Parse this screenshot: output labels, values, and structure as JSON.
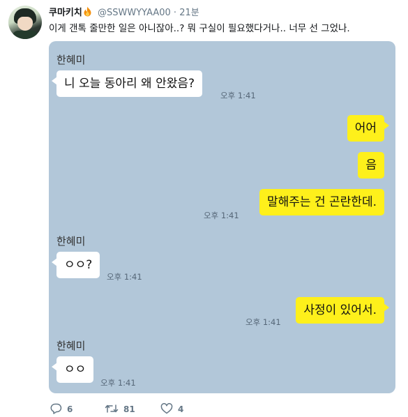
{
  "tweet": {
    "display_name": "쿠마키치",
    "handle": "@SSWWYYAA00",
    "separator": "·",
    "time": "21분",
    "text": "이게 갠톡 줄만한 일은 아니잖아..? 뭐 구실이 필요했다거나.. 너무 선 그었나."
  },
  "chat": {
    "bg_color": "#b2c7d9",
    "incoming_color": "#ffffff",
    "outgoing_color": "#fef01b",
    "messages": [
      {
        "sender": "한혜미",
        "text": "니 오늘 동아리 왜 안왔음?",
        "time": "오후 1:41"
      },
      {
        "text": "어어"
      },
      {
        "text": "음"
      },
      {
        "text": "말해주는 건 곤란한데.",
        "time": "오후 1:41"
      },
      {
        "sender": "한혜미",
        "text": "ㅇㅇ?",
        "time": "오후 1:41"
      },
      {
        "text": "사정이 있어서.",
        "time": "오후 1:41"
      },
      {
        "sender": "한혜미",
        "text": "ㅇㅇ",
        "time": "오후 1:41"
      }
    ]
  },
  "actions": {
    "reply_icon": "reply-icon",
    "reply_count": "6",
    "retweet_icon": "retweet-icon",
    "retweet_count": "81",
    "like_icon": "heart-icon",
    "like_count": "4"
  }
}
